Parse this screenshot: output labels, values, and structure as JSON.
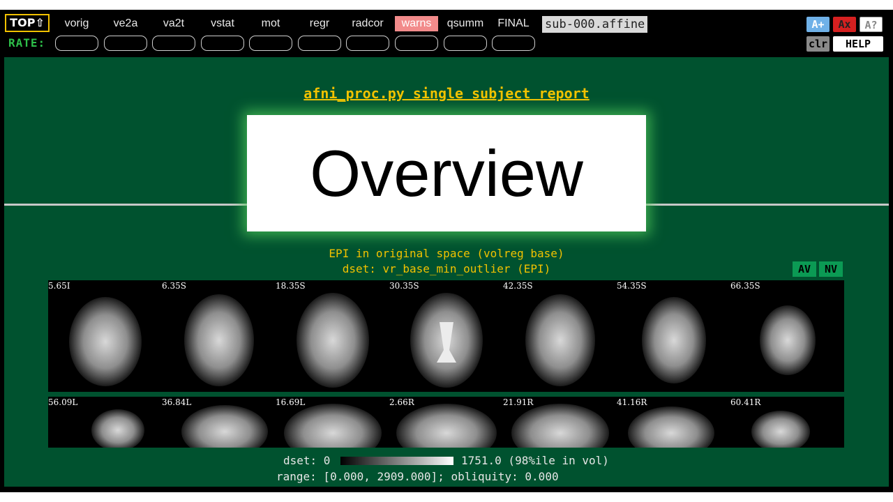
{
  "nav": {
    "top_label": "TOP⇧",
    "rate_label": "RATE:",
    "items": [
      {
        "label": "vorig"
      },
      {
        "label": "ve2a"
      },
      {
        "label": "va2t"
      },
      {
        "label": "vstat"
      },
      {
        "label": "mot"
      },
      {
        "label": "regr"
      },
      {
        "label": "radcor"
      },
      {
        "label": "warns"
      },
      {
        "label": "qsumm"
      },
      {
        "label": "FINAL"
      }
    ],
    "subject": "sub-000.affine",
    "buttons": {
      "a_plus": "A+",
      "a_x": "Ax",
      "a_q": "A?",
      "clr": "clr",
      "help": "HELP"
    }
  },
  "report": {
    "title": "afni_proc.py single subject report",
    "overlay_heading": "Overview"
  },
  "epi": {
    "caption_line1": "EPI in original space (volreg base)",
    "caption_line2": "dset: vr_base_min_outlier (EPI)",
    "av_label": "AV",
    "nv_label": "NV",
    "axial_labels": [
      "5.65I",
      "6.35S",
      "18.35S",
      "30.35S",
      "42.35S",
      "54.35S",
      "66.35S"
    ],
    "sagittal_labels": [
      "56.09L",
      "36.84L",
      "16.69L",
      "2.66R",
      "21.91R",
      "41.16R",
      "60.41R"
    ],
    "colorbar_min": "dset: 0",
    "colorbar_max": "1751.0 (98%ile in vol)",
    "range_text": "range: [0.000, 2909.000]; obliquity: 0.000"
  },
  "colors": {
    "page_bg": "#00522f",
    "accent_yellow": "#f2c200",
    "warn_pink": "#f28b8b",
    "rate_green": "#2ec04a"
  }
}
